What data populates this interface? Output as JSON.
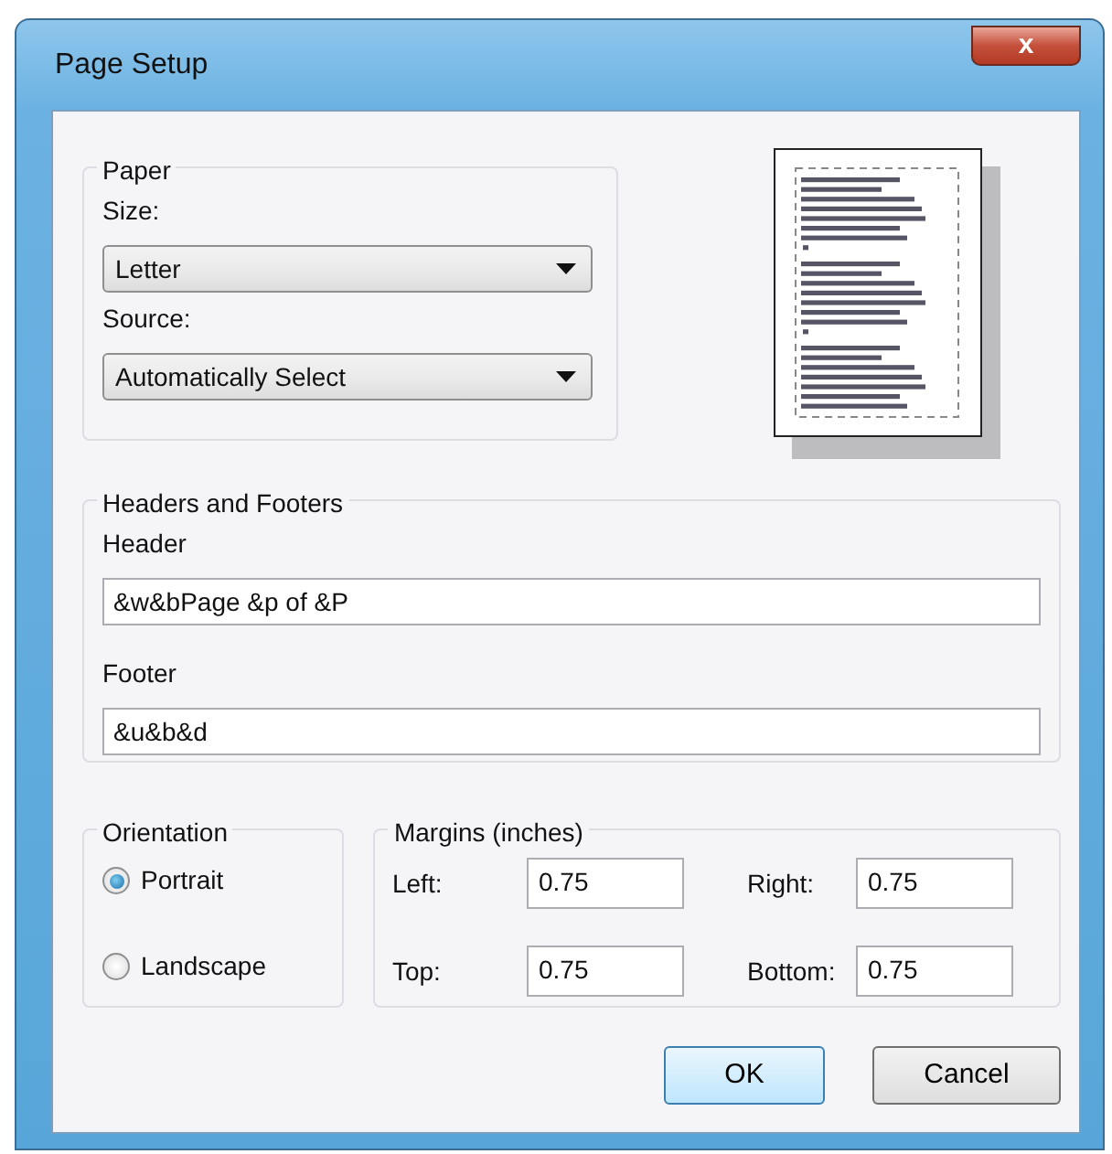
{
  "window": {
    "title": "Page Setup",
    "close": "x"
  },
  "paper": {
    "title": "Paper",
    "size_label": "Size:",
    "size_value": "Letter",
    "source_label": "Source:",
    "source_value": "Automatically Select"
  },
  "headers_footers": {
    "title": "Headers and Footers",
    "header_label": "Header",
    "header_value": "&w&bPage &p of &P",
    "footer_label": "Footer",
    "footer_value": "&u&b&d"
  },
  "orientation": {
    "title": "Orientation",
    "options": [
      {
        "label": "Portrait",
        "selected": true
      },
      {
        "label": "Landscape",
        "selected": false
      }
    ]
  },
  "margins": {
    "title": "Margins (inches)",
    "fields": [
      {
        "label": "Left:",
        "value": "0.75"
      },
      {
        "label": "Right:",
        "value": "0.75"
      },
      {
        "label": "Top:",
        "value": "0.75"
      },
      {
        "label": "Bottom:",
        "value": "0.75"
      }
    ]
  },
  "buttons": [
    {
      "label": "OK",
      "default": true
    },
    {
      "label": "Cancel",
      "default": false
    }
  ]
}
